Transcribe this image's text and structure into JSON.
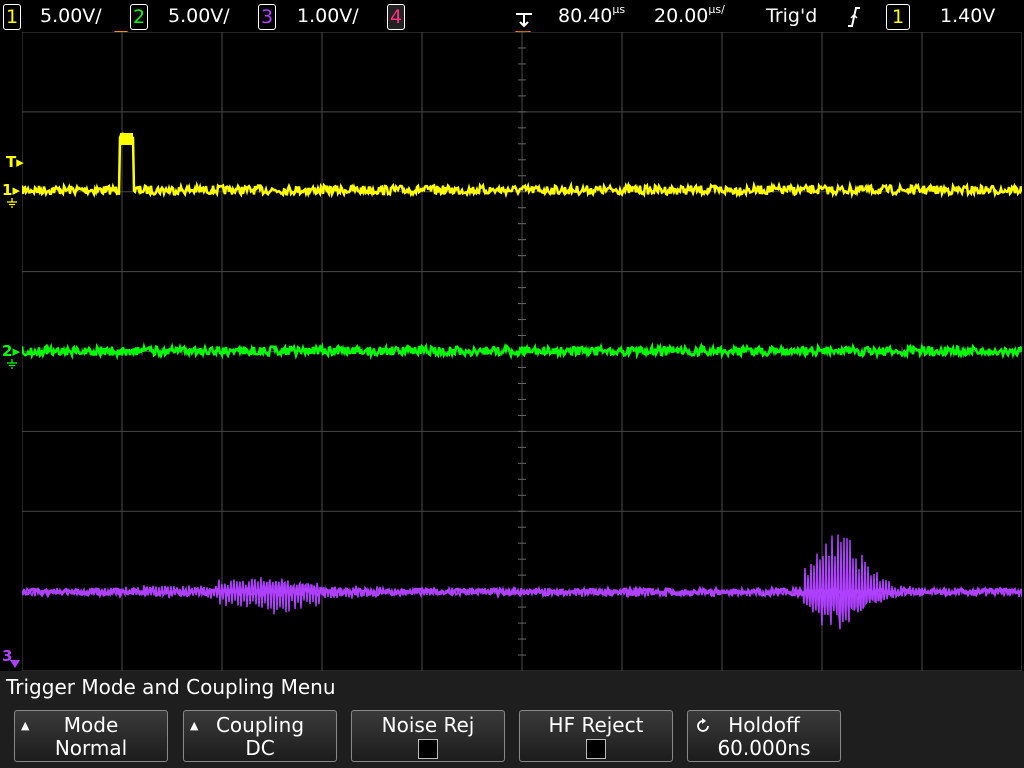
{
  "status": {
    "ch1": {
      "num": "1",
      "scale": "5.00V/"
    },
    "ch2": {
      "num": "2",
      "scale": "5.00V/"
    },
    "ch3": {
      "num": "3",
      "scale": "1.00V/"
    },
    "ch4": {
      "num": "4"
    },
    "delay": "80.40",
    "delay_unit": "us",
    "timebase": "20.00",
    "timebase_unit": "us/",
    "trig_status": "Trig'd",
    "trig_slope_icon": "rising-edge-icon",
    "trig_source": "1",
    "trig_level": "1.40V"
  },
  "markers": {
    "trigger": "T",
    "ch1": "1",
    "ch2": "2",
    "ch3": "3"
  },
  "colors": {
    "ch1": "#ffff00",
    "ch2": "#00ff00",
    "ch3": "#b040ff",
    "ch4": "#ff3080",
    "trigger_marker": "#ff8c00"
  },
  "menu": {
    "title": "Trigger Mode and Coupling Menu",
    "keys": [
      {
        "label": "Mode",
        "value": "Normal"
      },
      {
        "label": "Coupling",
        "value": "DC"
      },
      {
        "label": "Noise Rej",
        "value": ""
      },
      {
        "label": "HF Reject",
        "value": ""
      },
      {
        "label": "Holdoff",
        "value": "60.000ns"
      }
    ]
  }
}
